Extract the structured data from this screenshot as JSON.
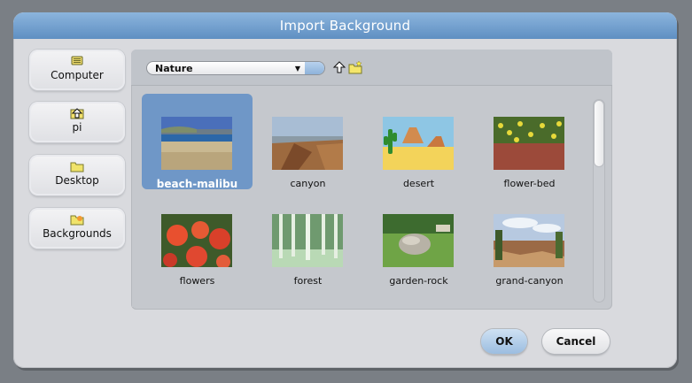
{
  "dialog": {
    "title": "Import Background"
  },
  "sidebar": {
    "items": [
      {
        "label": "Computer",
        "icon": "computer-icon"
      },
      {
        "label": "pi",
        "icon": "home-icon"
      },
      {
        "label": "Desktop",
        "icon": "folder-icon"
      },
      {
        "label": "Backgrounds",
        "icon": "backgrounds-folder-icon"
      }
    ]
  },
  "toolbar": {
    "folder_select": "Nature",
    "up_icon": "up-arrow-icon",
    "new_folder_icon": "new-folder-icon"
  },
  "files": {
    "items": [
      {
        "name": "beach-malibu",
        "selected": true
      },
      {
        "name": "canyon"
      },
      {
        "name": "desert"
      },
      {
        "name": "flower-bed"
      },
      {
        "name": "flowers"
      },
      {
        "name": "forest"
      },
      {
        "name": "garden-rock"
      },
      {
        "name": "grand-canyon"
      }
    ]
  },
  "footer": {
    "ok_label": "OK",
    "cancel_label": "Cancel"
  },
  "colors": {
    "title_bar": "#6f9ccb",
    "selection": "#6f97c7",
    "ok_button": "#a9c8e6"
  }
}
